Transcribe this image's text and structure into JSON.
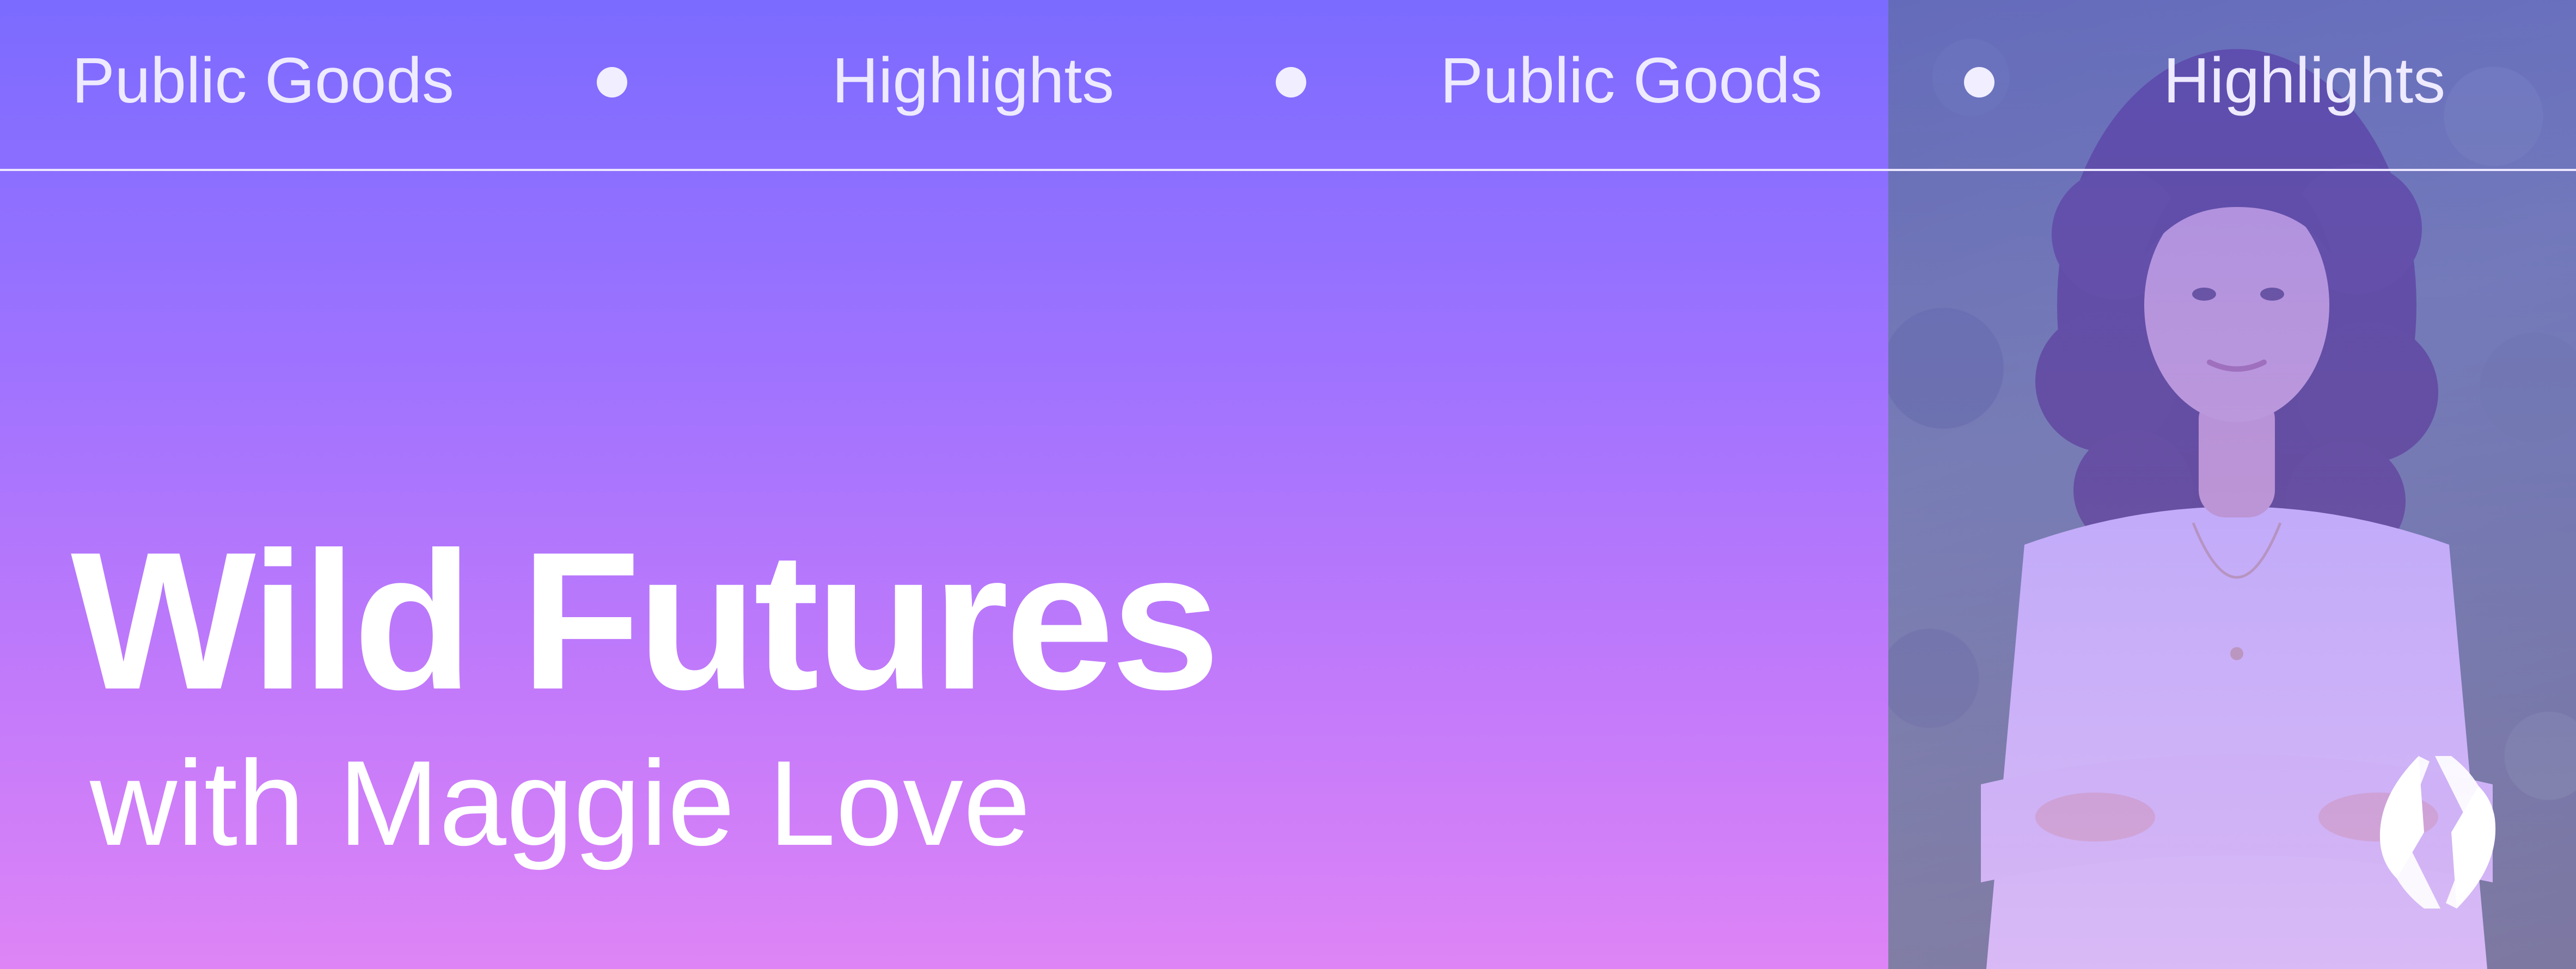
{
  "ticker": {
    "items": [
      "Public Goods",
      "Highlights",
      "Public Goods",
      "Highlights"
    ]
  },
  "headline": {
    "title": "Wild Futures",
    "subtitle": "with Maggie Love"
  },
  "photo": {
    "subject": "portrait-photo"
  },
  "logo": {
    "icon": "ens-logo-icon"
  },
  "colors": {
    "gradient_top": "#7b6bff",
    "gradient_bottom": "#de84f6",
    "text": "#ffffff",
    "ticker_text": "#eeeaff"
  }
}
